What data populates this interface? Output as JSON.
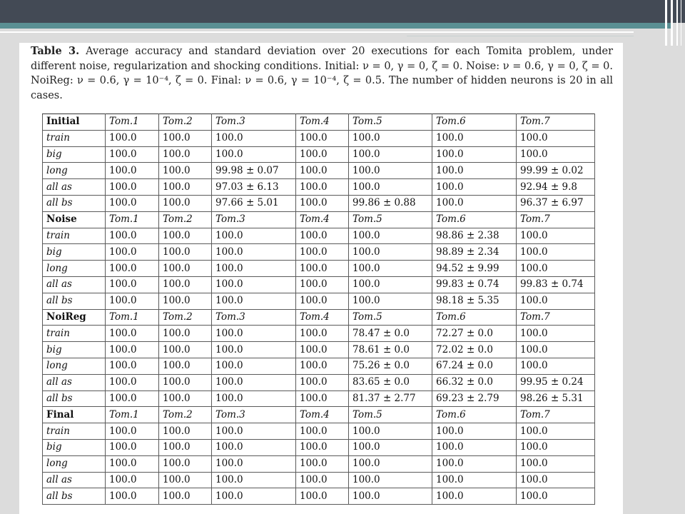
{
  "caption": {
    "label": "Table 3.",
    "text": "Average accuracy and standard deviation over 20 executions for each Tomita problem, under different noise, regularization and shocking conditions. Initial: ν = 0, γ = 0, ζ = 0. Noise: ν = 0.6, γ = 0, ζ = 0. NoiReg: ν = 0.6, γ = 10⁻⁴, ζ = 0. Final: ν = 0.6, γ = 10⁻⁴, ζ = 0.5. The number of hidden neurons is 20 in all cases."
  },
  "table": {
    "columns": [
      "Tom.1",
      "Tom.2",
      "Tom.3",
      "Tom.4",
      "Tom.5",
      "Tom.6",
      "Tom.7"
    ],
    "sections": [
      {
        "name": "Initial",
        "rows": [
          {
            "label": "train",
            "values": [
              "100.0",
              "100.0",
              "100.0",
              "100.0",
              "100.0",
              "100.0",
              "100.0"
            ]
          },
          {
            "label": "big",
            "values": [
              "100.0",
              "100.0",
              "100.0",
              "100.0",
              "100.0",
              "100.0",
              "100.0"
            ]
          },
          {
            "label": "long",
            "values": [
              "100.0",
              "100.0",
              "99.98 ± 0.07",
              "100.0",
              "100.0",
              "100.0",
              "99.99 ± 0.02"
            ]
          },
          {
            "label": "all as",
            "values": [
              "100.0",
              "100.0",
              "97.03 ± 6.13",
              "100.0",
              "100.0",
              "100.0",
              "92.94 ± 9.8"
            ]
          },
          {
            "label": "all bs",
            "values": [
              "100.0",
              "100.0",
              "97.66 ± 5.01",
              "100.0",
              "99.86 ± 0.88",
              "100.0",
              "96.37 ± 6.97"
            ]
          }
        ]
      },
      {
        "name": "Noise",
        "rows": [
          {
            "label": "train",
            "values": [
              "100.0",
              "100.0",
              "100.0",
              "100.0",
              "100.0",
              "98.86 ± 2.38",
              "100.0"
            ]
          },
          {
            "label": "big",
            "values": [
              "100.0",
              "100.0",
              "100.0",
              "100.0",
              "100.0",
              "98.89 ± 2.34",
              "100.0"
            ]
          },
          {
            "label": "long",
            "values": [
              "100.0",
              "100.0",
              "100.0",
              "100.0",
              "100.0",
              "94.52 ± 9.99",
              "100.0"
            ]
          },
          {
            "label": "all as",
            "values": [
              "100.0",
              "100.0",
              "100.0",
              "100.0",
              "100.0",
              "99.83 ± 0.74",
              "99.83 ± 0.74"
            ]
          },
          {
            "label": "all bs",
            "values": [
              "100.0",
              "100.0",
              "100.0",
              "100.0",
              "100.0",
              "98.18 ± 5.35",
              "100.0"
            ]
          }
        ]
      },
      {
        "name": "NoiReg",
        "rows": [
          {
            "label": "train",
            "values": [
              "100.0",
              "100.0",
              "100.0",
              "100.0",
              "78.47 ± 0.0",
              "72.27 ± 0.0",
              "100.0"
            ]
          },
          {
            "label": "big",
            "values": [
              "100.0",
              "100.0",
              "100.0",
              "100.0",
              "78.61 ± 0.0",
              "72.02 ± 0.0",
              "100.0"
            ]
          },
          {
            "label": "long",
            "values": [
              "100.0",
              "100.0",
              "100.0",
              "100.0",
              "75.26 ± 0.0",
              "67.24 ± 0.0",
              "100.0"
            ]
          },
          {
            "label": "all as",
            "values": [
              "100.0",
              "100.0",
              "100.0",
              "100.0",
              "83.65 ± 0.0",
              "66.32 ± 0.0",
              "99.95 ± 0.24"
            ]
          },
          {
            "label": "all bs",
            "values": [
              "100.0",
              "100.0",
              "100.0",
              "100.0",
              "81.37 ± 2.77",
              "69.23 ± 2.79",
              "98.26 ± 5.31"
            ]
          }
        ]
      },
      {
        "name": "Final",
        "rows": [
          {
            "label": "train",
            "values": [
              "100.0",
              "100.0",
              "100.0",
              "100.0",
              "100.0",
              "100.0",
              "100.0"
            ]
          },
          {
            "label": "big",
            "values": [
              "100.0",
              "100.0",
              "100.0",
              "100.0",
              "100.0",
              "100.0",
              "100.0"
            ]
          },
          {
            "label": "long",
            "values": [
              "100.0",
              "100.0",
              "100.0",
              "100.0",
              "100.0",
              "100.0",
              "100.0"
            ]
          },
          {
            "label": "all as",
            "values": [
              "100.0",
              "100.0",
              "100.0",
              "100.0",
              "100.0",
              "100.0",
              "100.0"
            ]
          },
          {
            "label": "all bs",
            "values": [
              "100.0",
              "100.0",
              "100.0",
              "100.0",
              "100.0",
              "100.0",
              "100.0"
            ]
          }
        ]
      }
    ]
  },
  "colors": {
    "header_bar": "#434a55",
    "accent_bar": "#5a8f93",
    "background": "#dcdcdc"
  }
}
